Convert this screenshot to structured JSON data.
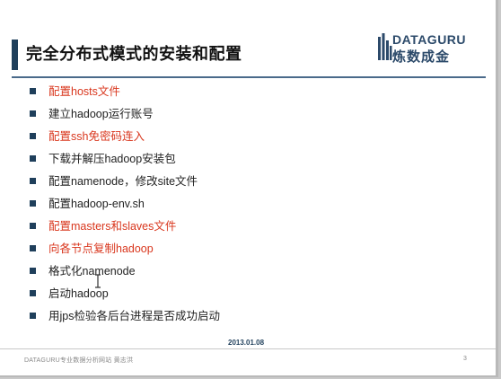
{
  "slide": {
    "title": "完全分布式模式的安装和配置",
    "logo": {
      "line1": "DATAGURU",
      "line2": "炼数成金"
    },
    "bullets": [
      {
        "text": "配置hosts文件",
        "color": "#d9371e"
      },
      {
        "text": "建立hadoop运行账号",
        "color": "#222222"
      },
      {
        "text": "配置ssh免密码连入",
        "color": "#d9371e"
      },
      {
        "text": "下载并解压hadoop安装包",
        "color": "#222222"
      },
      {
        "text": "配置namenode，修改site文件",
        "color": "#222222"
      },
      {
        "text": "配置hadoop-env.sh",
        "color": "#222222"
      },
      {
        "text": "配置masters和slaves文件",
        "color": "#d9371e"
      },
      {
        "text": "向各节点复制hadoop",
        "color": "#d9371e"
      },
      {
        "text": "格式化namenode",
        "color": "#222222"
      },
      {
        "text": "启动hadoop",
        "color": "#222222"
      },
      {
        "text": "用jps检验各后台进程是否成功启动",
        "color": "#222222"
      }
    ],
    "footer": {
      "date": "2013.01.08",
      "left": "DATAGURU专业数据分析网站 黄志洪",
      "page": "3"
    }
  },
  "colors": {
    "accent": "#1f3f5b",
    "highlight": "#d9371e"
  },
  "icons": {
    "cursor": "text-cursor-icon",
    "logo": "dataguru-logo"
  }
}
